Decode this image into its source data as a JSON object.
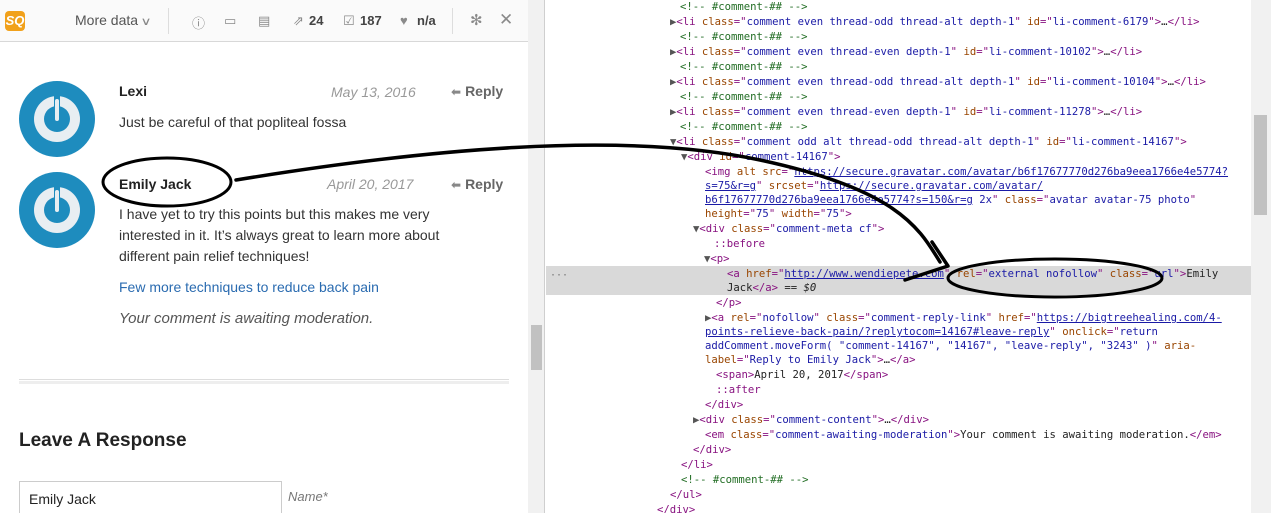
{
  "toolbar": {
    "logo": "SQ",
    "more_label": "More data",
    "share_count": "24",
    "links_count": "187",
    "rank_value": "n/a"
  },
  "comments": [
    {
      "author": "Lexi",
      "date": "May 13, 2016",
      "reply": "Reply",
      "text": "Just be careful of that popliteal fossa"
    },
    {
      "author": "Emily Jack",
      "date": "April 20, 2017",
      "reply": "Reply",
      "text": "I have yet to try this points but this makes me very interested in it. It’s always great to learn more about different pain relief techniques!",
      "link": "Few more techniques to reduce back pain",
      "moderation": "Your comment is awaiting moderation."
    }
  ],
  "respond": {
    "heading": "Leave A Response",
    "name_value": "Emily Jack",
    "name_label": "Name*"
  },
  "devtools": {
    "l0": "<!-- #comment-## -->",
    "l1_tag": "li",
    "l1_class": "comment even thread-odd thread-alt depth-1",
    "l1_id": "li-comment-6179",
    "l2": "<!-- #comment-## -->",
    "l3_class": "comment even thread-even depth-1",
    "l3_id": "li-comment-10102",
    "l4": "<!-- #comment-## -->",
    "l5_class": "comment even thread-odd thread-alt depth-1",
    "l5_id": "li-comment-10104",
    "l6": "<!-- #comment-## -->",
    "l7_class": "comment even thread-even depth-1",
    "l7_id": "li-comment-11278",
    "l8": "<!-- #comment-## -->",
    "l9_class": "comment odd alt thread-odd thread-alt depth-1",
    "l9_id": "li-comment-14167",
    "div_id": "comment-14167",
    "img_src_1": "https://secure.gravatar.com/avatar/b6f17677770d276ba9eea1766e4e5774?",
    "img_src_2": "s=75&r=g",
    "img_srcset_1": "https://secure.gravatar.com/avatar/",
    "img_srcset_2": "b6f17677770d276ba9eea1766e4e5774?s=150&r=g",
    "img_srcset_suffix": " 2x",
    "img_class": "avatar avatar-75 photo",
    "img_height": "75",
    "img_width": "75",
    "meta_class": "comment-meta cf",
    "before": "::before",
    "a_href": "http://www.wendiepete.com",
    "a_rel": "external nofollow",
    "a_class": "url",
    "a_text_1": "Emily",
    "a_text_2": "Jack",
    "eq": " == $0",
    "reply_rel": "nofollow",
    "reply_class": "comment-reply-link",
    "reply_href_1": "https://bigtreehealing.com/4-",
    "reply_href_2": "points-relieve-back-pain/?replytocom=14167#leave-reply",
    "reply_onclick_1": "return",
    "reply_onclick_2": "addComment.moveForm( \"comment-14167\", \"14167\", \"leave-reply\", \"3243\" )",
    "reply_aria_1": "aria-",
    "reply_aria_2": "Reply to Emily Jack",
    "span_text": "April 20, 2017",
    "after": "::after",
    "content_class": "comment-content",
    "em_class": "comment-awaiting-moderation",
    "em_text": "Your comment is awaiting moderation.",
    "l_end": "<!-- #comment-## -->"
  },
  "colors": {
    "avatar_blue": "#1e8cbe",
    "link_blue": "#2a6bb0",
    "annotation": "#000000"
  }
}
